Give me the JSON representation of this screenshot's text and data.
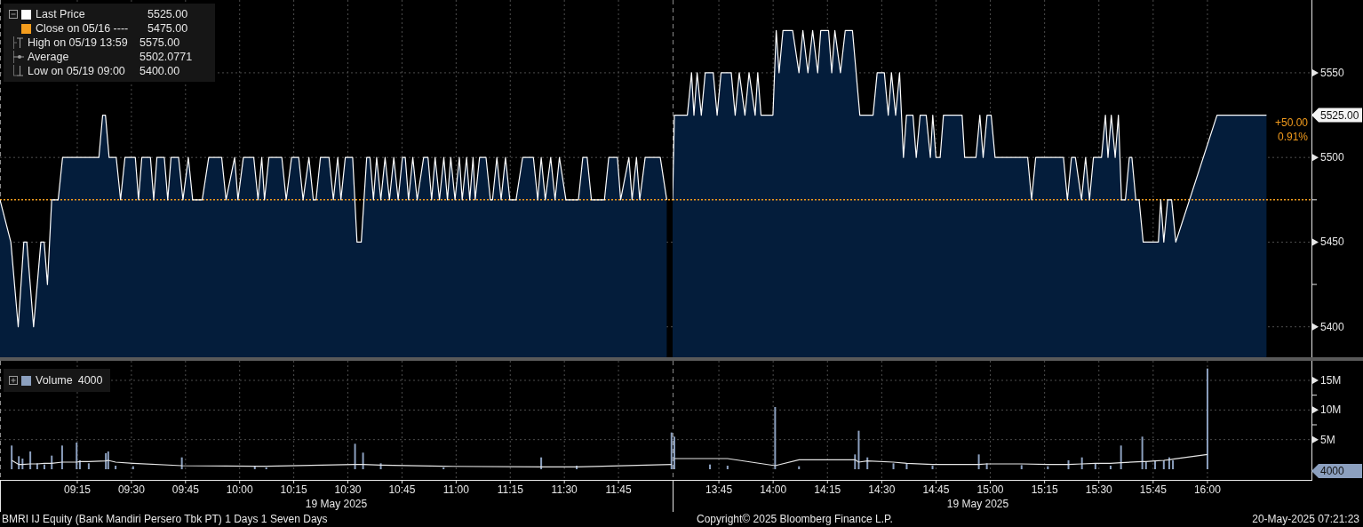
{
  "price_panel": {
    "legend": [
      {
        "kind": "swatch",
        "color": "#ffffff",
        "value": "5525.00"
      },
      {
        "kind": "swatch",
        "color": "#f39c1d",
        "label": "Close on 05/16 ----",
        "value": "5475.00"
      },
      {
        "kind": "high",
        "label": "High on 05/19 13:59",
        "value": "5575.00"
      },
      {
        "kind": "average",
        "label": "Average",
        "value": "5502.0771"
      },
      {
        "kind": "low",
        "label": "Low on 05/19 09:00",
        "value": "5400.00"
      }
    ],
    "last_tag": "5525.00",
    "change": "+50.00",
    "change_pct": "0.91%",
    "sessions": [
      {
        "chart_data": {
          "type": "area",
          "grid": true,
          "xlim": [
            8.893,
            12.0
          ],
          "ylim": [
            5382,
            5593
          ],
          "ref_lines": [
            {
              "axis": "y",
              "value": 5475,
              "color": "#f39c1d"
            }
          ],
          "x": [
            8.893,
            8.943,
            8.977,
            9.003,
            9.017,
            9.048,
            9.082,
            9.097,
            9.112,
            9.132,
            9.162,
            9.182,
            9.35,
            9.367,
            9.38,
            9.397,
            9.43,
            9.45,
            9.47,
            9.518,
            9.533,
            9.548,
            9.588,
            9.603,
            9.618,
            9.652,
            9.668,
            9.683,
            9.718,
            9.738,
            9.763,
            9.783,
            9.827,
            9.857,
            9.917,
            9.937,
            9.977,
            9.992,
            10.017,
            10.065,
            10.085,
            10.102,
            10.115,
            10.135,
            10.195,
            10.215,
            10.24,
            10.273,
            10.293,
            10.32,
            10.34,
            10.353,
            10.373,
            10.413,
            10.433,
            10.453,
            10.468,
            10.488,
            10.522,
            10.542,
            10.562,
            10.587,
            10.602,
            10.618,
            10.633,
            10.652,
            10.672,
            10.692,
            10.712,
            10.732,
            10.752,
            10.765,
            10.78,
            10.8,
            10.82,
            10.85,
            10.87,
            10.887,
            10.903,
            10.923,
            10.943,
            10.96,
            10.975,
            10.995,
            11.015,
            11.028,
            11.048,
            11.063,
            11.078,
            11.088,
            11.108,
            11.138,
            11.158,
            11.168,
            11.188,
            11.208,
            11.228,
            11.248,
            11.277,
            11.307,
            11.357,
            11.377,
            11.393,
            11.412,
            11.437,
            11.457,
            11.477,
            11.507,
            11.565,
            11.585,
            11.605,
            11.625,
            11.685,
            11.705,
            11.745,
            11.76,
            11.798,
            11.813,
            11.833,
            11.848,
            11.873,
            11.943,
            11.973
          ],
          "series": [
            {
              "name": "Last Price",
              "color": "#041d3b",
              "values": [
                5475,
                5450,
                5400,
                5450,
                5450,
                5400,
                5450,
                5450,
                5425,
                5475,
                5475,
                5500,
                5500,
                5525,
                5525,
                5500,
                5500,
                5475,
                5500,
                5500,
                5475,
                5500,
                5500,
                5475,
                5500,
                5500,
                5475,
                5500,
                5500,
                5475,
                5500,
                5475,
                5475,
                5500,
                5500,
                5475,
                5500,
                5475,
                5500,
                5500,
                5475,
                5500,
                5475,
                5500,
                5500,
                5475,
                5500,
                5500,
                5475,
                5500,
                5475,
                5475,
                5500,
                5500,
                5475,
                5500,
                5475,
                5500,
                5500,
                5450,
                5450,
                5500,
                5500,
                5475,
                5500,
                5475,
                5500,
                5475,
                5500,
                5475,
                5500,
                5500,
                5475,
                5500,
                5475,
                5500,
                5500,
                5475,
                5500,
                5475,
                5500,
                5475,
                5500,
                5475,
                5500,
                5475,
                5500,
                5475,
                5500,
                5475,
                5500,
                5500,
                5475,
                5475,
                5500,
                5475,
                5500,
                5475,
                5475,
                5500,
                5500,
                5475,
                5500,
                5475,
                5500,
                5475,
                5500,
                5475,
                5475,
                5500,
                5500,
                5475,
                5475,
                5500,
                5500,
                5475,
                5500,
                5475,
                5500,
                5475,
                5500,
                5500,
                5475
              ]
            }
          ]
        }
      },
      {
        "chart_data": {
          "type": "area",
          "grid": true,
          "xlim": [
            13.537,
            16.479
          ],
          "ylim": [
            5382,
            5593
          ],
          "yticks": [
            {
              "value": 5550,
              "label": "5550"
            },
            {
              "value": 5500,
              "label": "5500"
            },
            {
              "value": 5450,
              "label": "5450"
            },
            {
              "value": 5400,
              "label": "5400"
            }
          ],
          "ref_lines": [
            {
              "axis": "y",
              "value": 5475,
              "color": "#f39c1d"
            }
          ],
          "x": [
            13.537,
            13.545,
            13.605,
            13.624,
            13.635,
            13.65,
            13.669,
            13.687,
            13.724,
            13.742,
            13.76,
            13.807,
            13.825,
            13.844,
            13.87,
            13.889,
            13.917,
            13.929,
            13.944,
            13.999,
            14.014,
            14.027,
            14.045,
            14.09,
            14.119,
            14.137,
            14.16,
            14.182,
            14.205,
            14.219,
            14.255,
            14.27,
            14.284,
            14.31,
            14.332,
            14.365,
            14.399,
            14.46,
            14.479,
            14.512,
            14.53,
            14.545,
            14.564,
            14.582,
            14.6,
            14.614,
            14.644,
            14.659,
            14.677,
            14.705,
            14.724,
            14.735,
            14.75,
            14.769,
            14.784,
            14.87,
            14.882,
            14.934,
            14.952,
            14.967,
            14.985,
            15.004,
            15.022,
            15.172,
            15.19,
            15.209,
            15.337,
            15.355,
            15.374,
            15.392,
            15.42,
            15.439,
            15.457,
            15.475,
            15.512,
            15.53,
            15.542,
            15.557,
            15.575,
            15.59,
            15.604,
            15.622,
            15.64,
            15.652,
            15.67,
            15.685,
            15.704,
            15.774,
            15.785,
            15.799,
            15.817,
            15.835,
            15.854,
            16.044,
            16.272
          ],
          "series": [
            {
              "color": "#041d3b",
              "values": [
                5475,
                5525,
                5525,
                5550,
                5525,
                5550,
                5525,
                5550,
                5550,
                5525,
                5550,
                5550,
                5525,
                5550,
                5525,
                5550,
                5525,
                5550,
                5525,
                5525,
                5575,
                5550,
                5575,
                5575,
                5550,
                5575,
                5550,
                5575,
                5550,
                5575,
                5575,
                5550,
                5575,
                5550,
                5575,
                5575,
                5525,
                5525,
                5550,
                5550,
                5525,
                5550,
                5525,
                5550,
                5500,
                5525,
                5525,
                5500,
                5525,
                5525,
                5500,
                5525,
                5500,
                5500,
                5525,
                5525,
                5500,
                5500,
                5525,
                5500,
                5525,
                5525,
                5500,
                5500,
                5475,
                5500,
                5500,
                5475,
                5500,
                5500,
                5475,
                5500,
                5475,
                5500,
                5500,
                5525,
                5500,
                5525,
                5500,
                5525,
                5475,
                5475,
                5500,
                5500,
                5475,
                5475,
                5450,
                5450,
                5475,
                5450,
                5475,
                5475,
                5450,
                5525,
                5525
              ]
            }
          ]
        }
      }
    ]
  },
  "volume_panel": {
    "legend": {
      "value": "4000"
    },
    "last_tag": "4000",
    "sessions": [
      {
        "chart_data": {
          "type": "bar",
          "grid": true,
          "xlim": [
            8.893,
            12.0
          ],
          "ylim": [
            -1800000,
            18300000
          ],
          "xticks": [
            {
              "value": 9.25,
              "label": "09:15"
            },
            {
              "value": 9.5,
              "label": "09:30"
            },
            {
              "value": 9.75,
              "label": "09:45"
            },
            {
              "value": 10.0,
              "label": "10:00"
            },
            {
              "value": 10.25,
              "label": "10:15"
            },
            {
              "value": 10.5,
              "label": "10:30"
            },
            {
              "value": 10.75,
              "label": "10:45"
            },
            {
              "value": 11.0,
              "label": "11:00"
            },
            {
              "value": 11.25,
              "label": "11:15"
            },
            {
              "value": 11.5,
              "label": "11:30"
            },
            {
              "value": 11.75,
              "label": "11:45"
            }
          ],
          "x": [
            8.947,
            8.98,
            8.997,
            9.033,
            9.065,
            9.098,
            9.132,
            9.18,
            9.247,
            9.262,
            9.303,
            9.382,
            9.393,
            9.427,
            9.508,
            9.733,
            10.07,
            10.123,
            10.533,
            10.57,
            10.652,
            10.942,
            11.393,
            11.557,
            11.995
          ],
          "series": [
            {
              "name": "Volume",
              "color": "#8ca0bf",
              "values": [
                4000000,
                2200000,
                1800000,
                3000000,
                1000000,
                800000,
                2300000,
                4000000,
                4500000,
                1500000,
                1000000,
                2700000,
                3000000,
                600000,
                500000,
                2000000,
                500000,
                300000,
                4300000,
                2800000,
                1000000,
                300000,
                2000000,
                600000,
                6200000
              ]
            },
            {
              "type": "line",
              "color": "#e6e6e6",
              "values": [
                1500000,
                800000,
                800000,
                900000,
                900000,
                1000000,
                1000000,
                1200000,
                1200000,
                1300000,
                1300000,
                1400000,
                1500000,
                1200000,
                1000000,
                600000,
                500000,
                500000,
                800000,
                800000,
                700000,
                500000,
                400000,
                400000,
                800000
              ]
            }
          ]
        }
      },
      {
        "chart_data": {
          "type": "bar",
          "grid": true,
          "xlim": [
            13.537,
            16.479
          ],
          "ylim": [
            -1800000,
            18300000
          ],
          "xticks": [
            {
              "value": 13.75,
              "label": "13:45"
            },
            {
              "value": 14.0,
              "label": "14:00"
            },
            {
              "value": 14.25,
              "label": "14:15"
            },
            {
              "value": 14.5,
              "label": "14:30"
            },
            {
              "value": 14.75,
              "label": "14:45"
            },
            {
              "value": 15.0,
              "label": "15:00"
            },
            {
              "value": 15.25,
              "label": "15:15"
            },
            {
              "value": 15.5,
              "label": "15:30"
            },
            {
              "value": 15.75,
              "label": "15:45"
            },
            {
              "value": 16.0,
              "label": "16:00"
            }
          ],
          "yticks": [
            {
              "value": 15000000,
              "label": "15M"
            },
            {
              "value": 10000000,
              "label": "10M"
            },
            {
              "value": 5000000,
              "label": "5M"
            }
          ],
          "x": [
            13.545,
            13.709,
            13.79,
            14.009,
            14.119,
            14.377,
            14.394,
            14.434,
            14.554,
            14.615,
            14.734,
            14.947,
            14.984,
            15.144,
            15.265,
            15.36,
            15.422,
            15.484,
            15.554,
            15.602,
            15.7,
            15.717,
            15.759,
            15.799,
            15.824,
            15.841,
            16.0
          ],
          "series": [
            {
              "color": "#8ca0bf",
              "values": [
                5500000,
                800000,
                600000,
                10500000,
                500000,
                2500000,
                6500000,
                2000000,
                1000000,
                1000000,
                600000,
                2500000,
                1000000,
                700000,
                500000,
                1500000,
                2000000,
                1000000,
                600000,
                4000000,
                5500000,
                1200000,
                1500000,
                1500000,
                2000000,
                1500000,
                17000000
              ]
            },
            {
              "type": "line",
              "color": "#e6e6e6",
              "values": [
                1800000,
                1800000,
                1800000,
                600000,
                1600000,
                1600000,
                1200000,
                1400000,
                1200000,
                1000000,
                800000,
                800000,
                900000,
                900000,
                800000,
                800000,
                900000,
                1000000,
                1000000,
                1100000,
                1300000,
                1300000,
                1400000,
                1500000,
                1600000,
                1700000,
                2500000
              ]
            }
          ]
        }
      }
    ]
  },
  "time_axis": {
    "date_labels": [
      "19 May 2025",
      "19 May 2025"
    ]
  },
  "footer": {
    "security": "BMRI IJ Equity (Bank Mandiri Persero Tbk PT) 1 Days 1 Seven Days",
    "copyright": "Copyright© 2025 Bloomberg Finance L.P.",
    "timestamp": "20-May-2025 07:21:23"
  }
}
